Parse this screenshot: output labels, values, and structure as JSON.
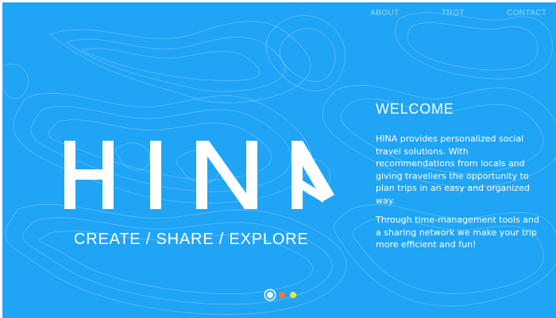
{
  "nav": {
    "items": [
      {
        "label": "ABOUT"
      },
      {
        "label": "TROT"
      },
      {
        "label": "CONTACT"
      }
    ]
  },
  "hero": {
    "logo_text": "HINA",
    "tagline": "CREATE / SHARE / EXPLORE"
  },
  "about": {
    "heading": "WELCOME",
    "paragraph1": "HINA provides personalized social travel solutions. With recommendations from locals and giving travellers the opportunity to plan trips in an easy and organized way.",
    "paragraph2": "Through time-management tools and a sharing network we make your trip more efficient and fun!"
  },
  "carousel": {
    "active_index": 0,
    "dots": [
      {
        "color": "#ffffff"
      },
      {
        "color": "#f5793a"
      },
      {
        "color": "#f2e33a"
      }
    ]
  },
  "colors": {
    "background": "#1fa4f6",
    "text": "#ffffff"
  }
}
